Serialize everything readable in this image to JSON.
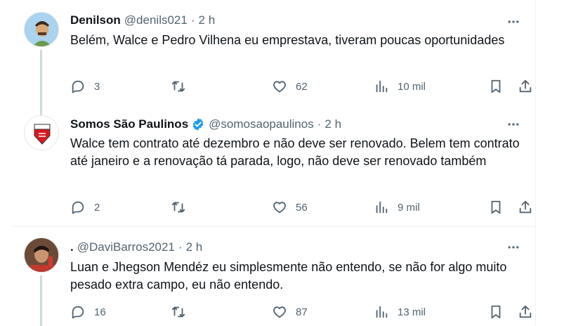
{
  "tweets": [
    {
      "name": "Denilson",
      "handle": "@denils021",
      "time": "2 h",
      "verified": false,
      "text": "Belém, Walce e Pedro Vilhena eu emprestava, tiveram poucas oportunidades",
      "replies": "3",
      "retweets": "",
      "likes": "62",
      "views": "10 mil"
    },
    {
      "name": "Somos São Paulinos",
      "handle": "@somosaopaulinos",
      "time": "2 h",
      "verified": true,
      "text": "Walce tem contrato até dezembro e não deve ser renovado. Belem tem contrato até janeiro e a renovação tá parada, logo, não deve ser renovado também",
      "replies": "2",
      "retweets": "",
      "likes": "56",
      "views": "9 mil"
    },
    {
      "name": ".",
      "handle": "@DaviBarros2021",
      "time": "2 h",
      "verified": false,
      "text": "Luan e Jhegson Mendéz eu simplesmente não entendo, se não for algo muito pesado extra campo, eu não entendo.",
      "replies": "16",
      "retweets": "",
      "likes": "87",
      "views": "13 mil"
    }
  ],
  "separator": "·",
  "icons": {
    "more": "more-options-icon",
    "reply": "reply-icon",
    "retweet": "retweet-icon",
    "like": "heart-icon",
    "views": "views-chart-icon",
    "bookmark": "bookmark-icon",
    "share": "share-icon",
    "verified": "verified-badge-icon"
  },
  "colors": {
    "text": "#0f1419",
    "secondary": "#536471",
    "verified": "#1d9bf0",
    "divider": "#eff3f4",
    "thread": "#cfd9de"
  }
}
